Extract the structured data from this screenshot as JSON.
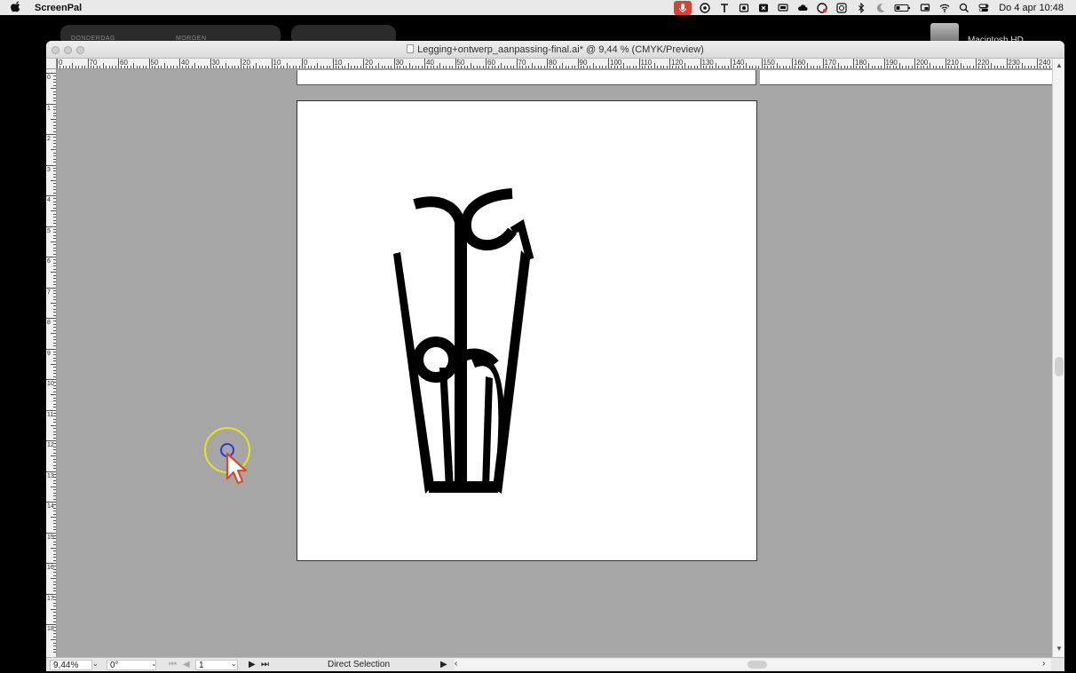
{
  "menubar": {
    "app_name": "ScreenPal",
    "clock": "Do 4 apr  10:48"
  },
  "desktop": {
    "widget_left_label_1": "DONDERDAG",
    "widget_left_label_2": "MORGEN",
    "drive_label": "Macintosh HD"
  },
  "window": {
    "title": "Legging+ontwerp_aanpassing-final.ai* @ 9,44 % (CMYK/Preview)"
  },
  "ruler": {
    "h_labels": [
      "0",
      "70",
      "60",
      "50",
      "40",
      "30",
      "20",
      "10",
      "0",
      "10",
      "20",
      "30",
      "40",
      "50",
      "60",
      "70",
      "80",
      "90",
      "100",
      "110",
      "120",
      "130",
      "140",
      "150",
      "160",
      "170",
      "180",
      "190",
      "200",
      "210",
      "220",
      "230",
      "240"
    ],
    "v_labels": [
      "0",
      "1",
      "2",
      "3",
      "4",
      "5",
      "6",
      "7",
      "8",
      "9",
      "10",
      "11",
      "12",
      "13",
      "14",
      "15",
      "16",
      "17",
      "18"
    ]
  },
  "statusbar": {
    "zoom": "9,44%",
    "rotation": "0°",
    "artboard_number": "1",
    "tool": "Direct Selection"
  }
}
